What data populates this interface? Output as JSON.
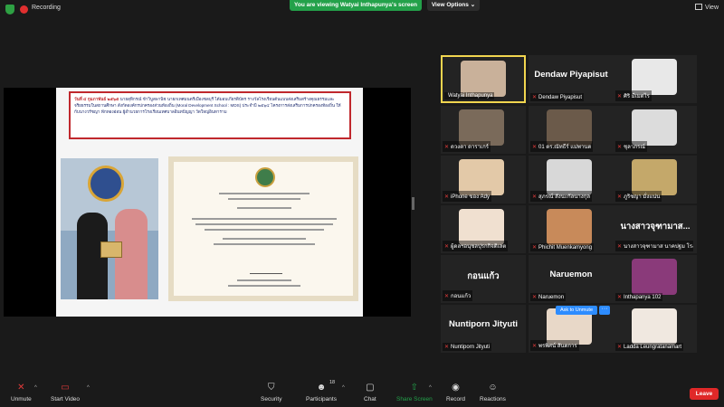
{
  "topbar": {
    "recording_label": "Recording",
    "viewing_banner": "You are viewing Watyai Inthapunya's screen",
    "view_options_label": "View Options ⌄",
    "view_label": "View"
  },
  "slide": {
    "caption_date": "วันที่ ๔ กุมภาพันธ์ ๒๕๖๕",
    "caption_text": "นายสุทิกรณ์ ข้าวิบูลพานิช นายกเทศมนตรีเมืองชลบุรี ได้มอบเกียรติบัตร รางวัลโรงเรียนต้นแบบส่งเสริมสร้างคุณธรรมและจริยธรรมในสถานศึกษา สังกัดองค์กรปกครองส่วนท้องถิ่น (Moral Development School : MDS) ประจำปี ๒๕๖๔ โครงการส่งเสริมการปกครองท้องถิ่น ให้กับนางวรัชญา ฟักทองอ่อน ผู้อำนวยการโรงเรียนเทศบาลอินทปัญญา วัดใหญ่อินทาราม"
  },
  "gallery": {
    "tiles": [
      {
        "big": "",
        "label": "Watyai Inthapunya"
      },
      {
        "big": "Dendaw Piyapisut",
        "label": "Dendaw Piyapisut"
      },
      {
        "big": "",
        "label": "ศิริ มีเมตไร"
      },
      {
        "big": "",
        "label": "ดวงตา ดาราเกร์"
      },
      {
        "big": "",
        "label": "01 ดร.ณัทธีร์ แม่พานต"
      },
      {
        "big": "",
        "label": "ชุลาภรณ์"
      },
      {
        "big": "",
        "label": "iPhone ของ Ady"
      },
      {
        "big": "",
        "label": "สุภรณ์ สังนะกัลนางกุล"
      },
      {
        "big": "",
        "label": "ภูริชญา มั่งแน่น"
      },
      {
        "big": "",
        "label": "ผู้ดลฯอนุชลปุรกกิจติเลต"
      },
      {
        "big": "",
        "label": "Phichit Muenkamyong"
      },
      {
        "big": "นางสาวจุฑามาส...",
        "label": "นางสาวจุฑามาส นาคปฐม โรง..."
      },
      {
        "big": "กอนแก้ว",
        "label": "กอนแก้ว"
      },
      {
        "big": "Naruemon",
        "label": "Naruemon"
      },
      {
        "big": "",
        "label": "Inthapanya 102"
      },
      {
        "big": "Nuntiporn Jityuti",
        "label": "Nuntiporn Jityuti"
      },
      {
        "big": "",
        "label": "พรพิศน์ สันตการ"
      },
      {
        "big": "",
        "label": "Ladda Leungratanamart"
      }
    ],
    "ask_to_unmute": "Ask to Unmute",
    "more": "···"
  },
  "toolbar": {
    "unmute": "Unmute",
    "start_video": "Start Video",
    "security": "Security",
    "participants": "Participants",
    "participants_count": "18",
    "chat": "Chat",
    "share_screen": "Share Screen",
    "record": "Record",
    "reactions": "Reactions",
    "leave": "Leave"
  },
  "colors": {
    "accent_green": "#23a14a",
    "accent_blue": "#2d8cff",
    "leave_red": "#e02828",
    "active_speaker": "#f1d54f"
  }
}
